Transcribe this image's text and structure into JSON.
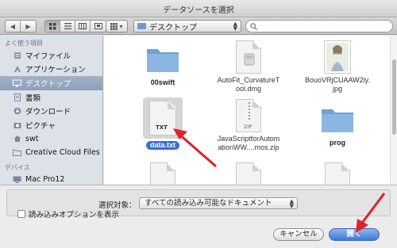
{
  "window": {
    "title": "データソースを選択"
  },
  "toolbar": {
    "back_icon": "chevron-left-icon",
    "forward_icon": "chevron-right-icon",
    "location": "デスクトップ",
    "search_placeholder": ""
  },
  "sidebar": {
    "sections": [
      {
        "header": "よく使う項目",
        "items": [
          {
            "label": "マイファイル",
            "icon": "all-my-files-icon"
          },
          {
            "label": "アプリケーション",
            "icon": "applications-icon"
          },
          {
            "label": "デスクトップ",
            "icon": "desktop-icon",
            "selected": true
          },
          {
            "label": "書類",
            "icon": "documents-icon"
          },
          {
            "label": "ダウンロード",
            "icon": "downloads-icon"
          },
          {
            "label": "ピクチャ",
            "icon": "pictures-icon"
          },
          {
            "label": "swt",
            "icon": "home-icon"
          },
          {
            "label": "Creative Cloud Files",
            "icon": "folder-icon"
          }
        ]
      },
      {
        "header": "デバイス",
        "items": [
          {
            "label": "Mac Pro12",
            "icon": "computer-icon"
          }
        ]
      }
    ]
  },
  "files": [
    {
      "name": "00swift",
      "kind": "folder"
    },
    {
      "name": "AutoFit_CurvatureTool.dmg",
      "name_lines": [
        "AutoFit_CurvatureT",
        "ool.dmg"
      ],
      "kind": "dmg"
    },
    {
      "name": "BouoVRjCUAAW2iy.jpg",
      "name_lines": [
        "BouoVRjCUAAW2iy.",
        "jpg"
      ],
      "kind": "image"
    },
    {
      "name": "data.txt",
      "kind": "txt",
      "selected": true,
      "badge": "TXT"
    },
    {
      "name": "JavaScriptforAutomationWW...mos.zip",
      "name_lines": [
        "JavaScriptforAutom",
        "ationWW....mos.zip"
      ],
      "kind": "zip",
      "badge": "ZIP"
    },
    {
      "name": "prog",
      "kind": "folder"
    }
  ],
  "bottom": {
    "filter_label": "選択対象：",
    "filter_value": "すべての読み込み可能なドキュメント",
    "options_label": "読み込みオプションを表示",
    "cancel_label": "キャンセル",
    "open_label": "開く"
  },
  "colors": {
    "accent": "#3b6fd4",
    "annotation_arrow": "#e0202a",
    "folder": "#6ea1d6"
  }
}
